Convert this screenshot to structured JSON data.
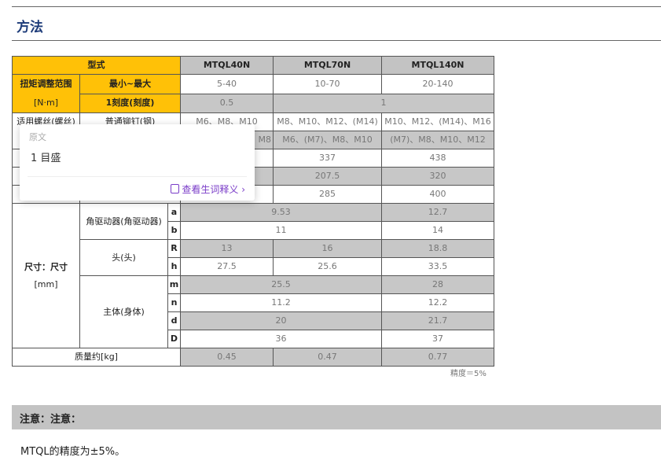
{
  "section_title": "方法",
  "table": {
    "header": {
      "type": "型式",
      "models": [
        "MTQL40N",
        "MTQL70N",
        "MTQL140N"
      ]
    },
    "torque": {
      "label": "扭矩调整范围",
      "unit": "[N·m]",
      "range_label": "最小~最大",
      "ranges": [
        "5-40",
        "10-70",
        "20-140"
      ],
      "scale_label": "1刻度(刻度)",
      "scale_values": [
        "0.5",
        "1"
      ]
    },
    "bolt": {
      "label": "适用螺丝(螺丝)",
      "row1_label": "普通铆钉(钢)",
      "row1": [
        "M6、M8、M10",
        "M8、M10、M12、(M14)",
        "M10、M12、(M14)、M16"
      ],
      "row2_tail": "M8",
      "row2": [
        "M6、(M7)、M8、M10",
        "(M7)、M8、M10、M12"
      ]
    },
    "length_rows": [
      [
        "337",
        "438"
      ],
      [
        "207.5",
        "320"
      ],
      [
        "285",
        "400"
      ]
    ],
    "dimension": {
      "label": "尺寸：尺寸",
      "unit": "[mm]",
      "angle_driver": "角驱动器(角驱动器)",
      "head": "头(头)",
      "body": "主体(身体)",
      "a": {
        "key": "a",
        "v": [
          "9.53",
          "12.7"
        ]
      },
      "b": {
        "key": "b",
        "v": [
          "11",
          "14"
        ]
      },
      "R": {
        "key": "R",
        "v": [
          "13",
          "16",
          "18.8"
        ]
      },
      "h": {
        "key": "h",
        "v": [
          "27.5",
          "25.6",
          "33.5"
        ]
      },
      "m": {
        "key": "m",
        "v": [
          "25.5",
          "28"
        ]
      },
      "n": {
        "key": "n",
        "v": [
          "11.2",
          "12.2"
        ]
      },
      "d": {
        "key": "d",
        "v": [
          "20",
          "21.7"
        ]
      },
      "D": {
        "key": "D",
        "v": [
          "36",
          "37"
        ]
      }
    },
    "mass": {
      "label": "质量约[kg]",
      "values": [
        "0.45",
        "0.47",
        "0.77"
      ]
    }
  },
  "accuracy": "精度＝5%",
  "popup": {
    "head": "原文",
    "text": "1 目盛",
    "link": "查看生词释义 ›"
  },
  "note": {
    "title": "注意：注意：",
    "text": "MTQL的精度为±5%。"
  }
}
